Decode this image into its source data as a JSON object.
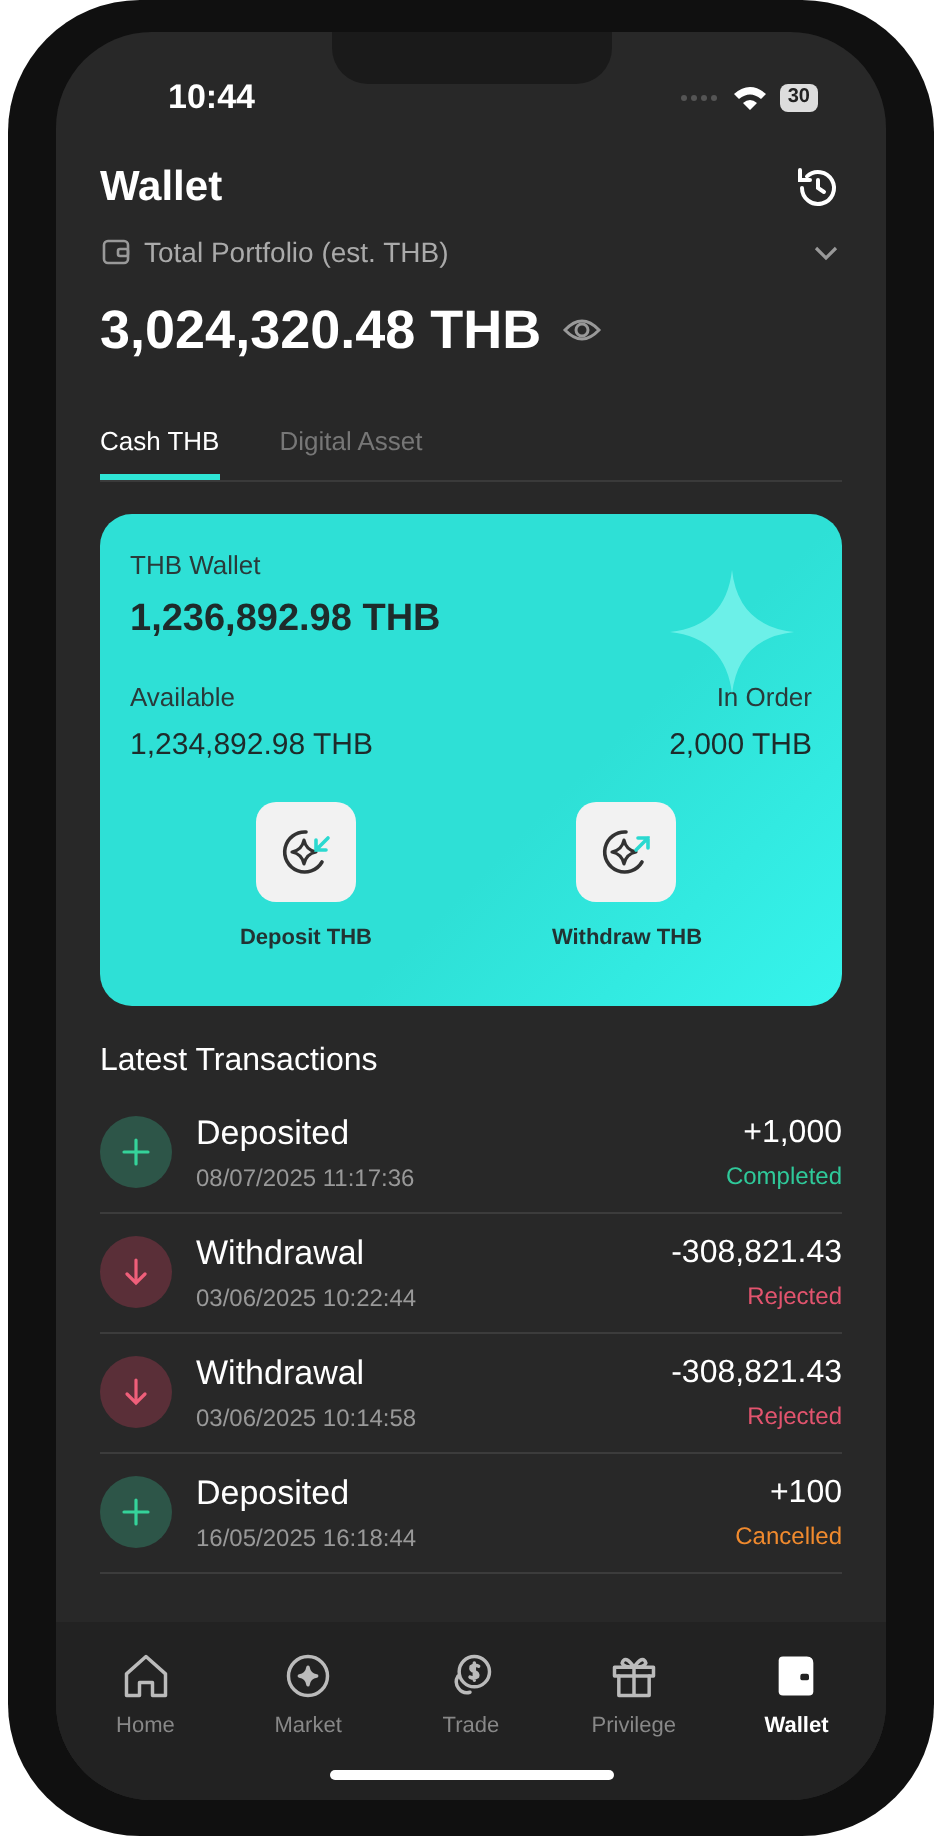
{
  "status_bar": {
    "time": "10:44",
    "battery": "30"
  },
  "header": {
    "title": "Wallet",
    "portfolio_label": "Total Portfolio (est. THB)",
    "total": "3,024,320.48 THB"
  },
  "tabs": [
    {
      "label": "Cash THB",
      "selected": true
    },
    {
      "label": "Digital Asset",
      "selected": false
    }
  ],
  "card": {
    "title": "THB Wallet",
    "balance": "1,236,892.98 THB",
    "available_label": "Available",
    "available": "1,234,892.98 THB",
    "in_order_label": "In Order",
    "in_order": "2,000 THB",
    "actions": [
      {
        "label": "Deposit THB",
        "kind": "deposit"
      },
      {
        "label": "Withdraw THB",
        "kind": "withdraw"
      }
    ]
  },
  "transactions_title": "Latest Transactions",
  "transactions": [
    {
      "kind": "deposit",
      "title": "Deposited",
      "time": "08/07/2025 11:17:36",
      "amount": "+1,000",
      "status": "Completed",
      "color": "#2fc99a"
    },
    {
      "kind": "withdrawal",
      "title": "Withdrawal",
      "time": "03/06/2025 10:22:44",
      "amount": "-308,821.43",
      "status": "Rejected",
      "color": "#e2546e"
    },
    {
      "kind": "withdrawal",
      "title": "Withdrawal",
      "time": "03/06/2025 10:14:58",
      "amount": "-308,821.43",
      "status": "Rejected",
      "color": "#e2546e"
    },
    {
      "kind": "deposit",
      "title": "Deposited",
      "time": "16/05/2025 16:18:44",
      "amount": "+100",
      "status": "Cancelled",
      "color": "#f08a2e"
    }
  ],
  "nav": [
    {
      "label": "Home",
      "kind": "home",
      "selected": false
    },
    {
      "label": "Market",
      "kind": "market",
      "selected": false
    },
    {
      "label": "Trade",
      "kind": "trade",
      "selected": false
    },
    {
      "label": "Privilege",
      "kind": "privilege",
      "selected": false
    },
    {
      "label": "Wallet",
      "kind": "wallet",
      "selected": true
    }
  ]
}
